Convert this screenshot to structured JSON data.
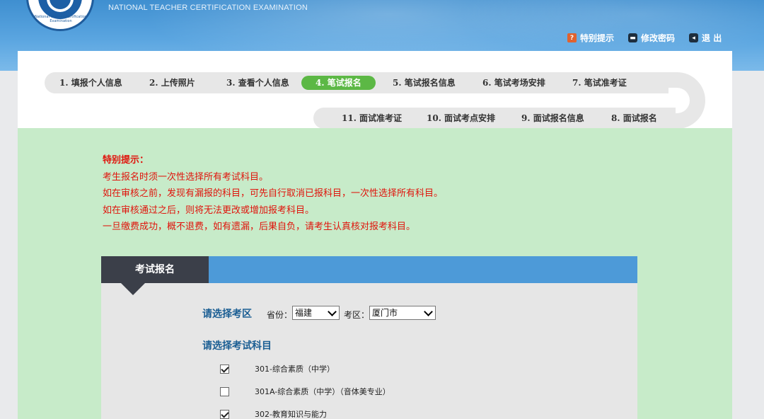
{
  "header": {
    "logo_ring_text": "National Teacher Certification Examination",
    "brand_en": "NATIONAL TEACHER CERTIFICATION EXAMINATION",
    "links": {
      "tip": "特别提示",
      "password": "修改密码",
      "exit": "退 出"
    }
  },
  "steps": [
    {
      "label": "1. 填报个人信息"
    },
    {
      "label": "2. 上传照片"
    },
    {
      "label": "3. 查看个人信息"
    },
    {
      "label": "4. 笔试报名",
      "active": true
    },
    {
      "label": "5. 笔试报名信息"
    },
    {
      "label": "6. 笔试考场安排"
    },
    {
      "label": "7. 笔试准考证"
    },
    {
      "label": "11. 面试准考证"
    },
    {
      "label": "10. 面试考点安排"
    },
    {
      "label": "9. 面试报名信息"
    },
    {
      "label": "8. 面试报名"
    }
  ],
  "notice": {
    "title": "特别提示：",
    "lines": [
      "考生报名时须一次性选择所有考试科目。",
      "如在审核之前，发现有漏报的科目，可先自行取消已报科目，一次性选择所有科目。",
      "如在审核通过之后，则将无法更改或增加报考科目。",
      "一旦缴费成功，概不退费，如有遗漏，后果自负，请考生认真核对报考科目。"
    ]
  },
  "form": {
    "tab_label": "考试报名",
    "area_heading": "请选择考区",
    "province_label": "省份：",
    "province_value": "福建",
    "district_label": "考区：",
    "district_value": "厦门市",
    "subject_heading": "请选择考试科目",
    "subjects": [
      {
        "label": "301-综合素质（中学）",
        "checked": true
      },
      {
        "label": "301A-综合素质（中学）（音体美专业）",
        "checked": false
      },
      {
        "label": "302-教育知识与能力",
        "checked": true
      }
    ]
  },
  "colors": {
    "header_blue": "#4d9ad8",
    "active_step_green": "#5cb845",
    "content_green": "#c7ebc9",
    "notice_red": "#e0140c",
    "heading_blue": "#1b5e93",
    "tab_dark": "#3b3f49"
  }
}
